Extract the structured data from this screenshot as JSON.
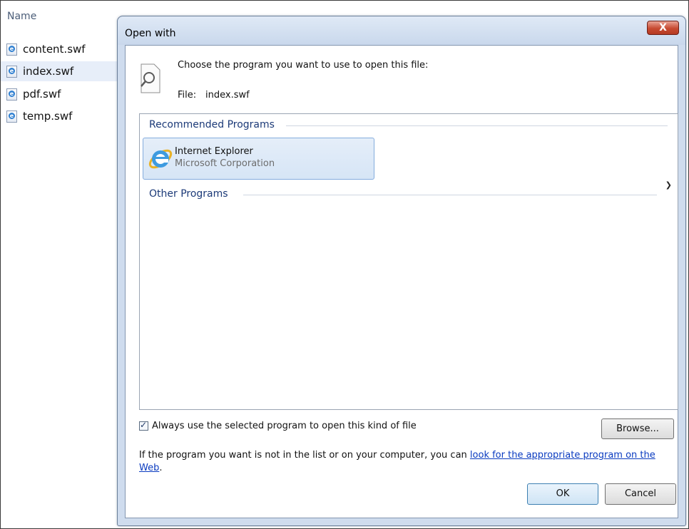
{
  "explorer": {
    "column_header": "Name",
    "files": [
      {
        "name": "content.swf",
        "selected": false
      },
      {
        "name": "index.swf",
        "selected": true
      },
      {
        "name": "pdf.swf",
        "selected": false
      },
      {
        "name": "temp.swf",
        "selected": false
      }
    ]
  },
  "dialog": {
    "title": "Open with",
    "close_label": "X",
    "prompt": "Choose the program you want to use to open this file:",
    "file_label": "File:",
    "file_name": "index.swf",
    "recommended_title": "Recommended Programs",
    "recommended_programs": [
      {
        "name": "Internet Explorer",
        "vendor": "Microsoft Corporation",
        "icon": "internet-explorer-icon"
      }
    ],
    "other_title": "Other Programs",
    "always_use_label": "Always use the selected program to open this kind of file",
    "always_use_checked": true,
    "browse_label": "Browse...",
    "info_text": "If the program you want is not in the list or on your computer, you can ",
    "info_link": "look for the appropriate program on the Web",
    "info_end": ".",
    "ok_label": "OK",
    "cancel_label": "Cancel"
  },
  "colors": {
    "dialog_frame": "#cfdcee",
    "section_title": "#1c3a78",
    "link": "#0a3bc0",
    "close_button": "#c74a31",
    "selection": "#e7eef9"
  }
}
